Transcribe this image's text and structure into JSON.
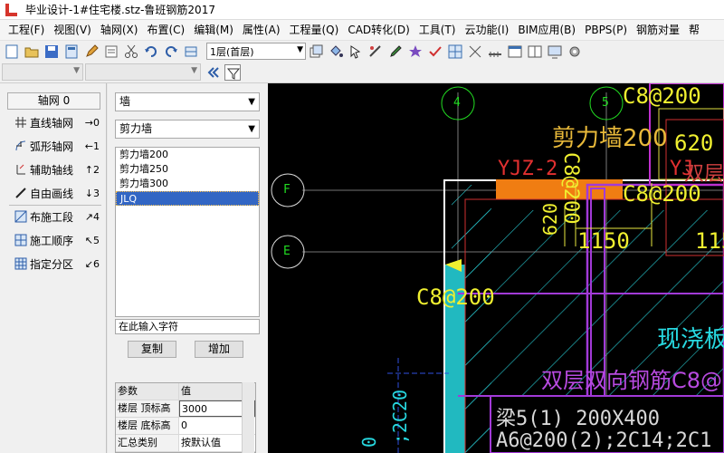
{
  "window": {
    "title": "毕业设计-1#住宅楼.stz-鲁班钢筋2017"
  },
  "menu": [
    "工程(F)",
    "视图(V)",
    "轴网(X)",
    "布置(C)",
    "编辑(M)",
    "属性(A)",
    "工程量(Q)",
    "CAD转化(D)",
    "工具(T)",
    "云功能(I)",
    "BIM应用(B)",
    "PBPS(P)",
    "钢筋对量",
    "帮"
  ],
  "toolbar": {
    "floor_select": "1层(首层)"
  },
  "left_panel": {
    "header": "轴网 0",
    "items": [
      {
        "label": "直线轴网",
        "key": "→0"
      },
      {
        "label": "弧形轴网",
        "key": "←1"
      },
      {
        "label": "辅助轴线",
        "key": "↑2"
      },
      {
        "label": "自由画线",
        "key": "↓3"
      },
      {
        "label": "布施工段",
        "key": "↗4"
      },
      {
        "label": "施工顺序",
        "key": "↖5"
      },
      {
        "label": "指定分区",
        "key": "↙6"
      }
    ]
  },
  "prop_panel": {
    "category": "墙",
    "subcategory": "剪力墙",
    "list": [
      "剪力墙200",
      "剪力墙250",
      "剪力墙300",
      "JLQ"
    ],
    "selected_index": 3,
    "input_placeholder": "在此输入字符",
    "copy_button": "复制",
    "add_button": "增加",
    "grid_header": {
      "key": "参数",
      "value": "值"
    },
    "grid_rows": [
      {
        "key": "楼层 顶标高",
        "value": "3000"
      },
      {
        "key": "楼层 底标高",
        "value": "0"
      },
      {
        "key": "汇总类别",
        "value": "按默认值"
      }
    ]
  },
  "canvas": {
    "axis_labels": {
      "a4": "4",
      "a5": "5",
      "aF": "F",
      "aE": "E"
    },
    "texts": {
      "c8_top": "C8@200",
      "shear_wall": "剪力墙200",
      "dim620_top": "620",
      "yjz2": "YJZ-2",
      "yjz_right": "YJ",
      "double_layer_small": "双层",
      "c8_vertical": "C8@200",
      "c8_mid": "C8@200",
      "dim620_vertical": "620",
      "dim1150": "1150",
      "dim115_right": "115",
      "c8_left": "C8@200",
      "cast_in_place": "现浇板",
      "double_layer_full": "双层双向钢筋C8@",
      "beam": "梁5(1)  200X400",
      "beam_rebar": "A6@200(2);2C14;2C1",
      "vertical_2c20": ";2C20",
      "vertical_left": "0"
    }
  }
}
